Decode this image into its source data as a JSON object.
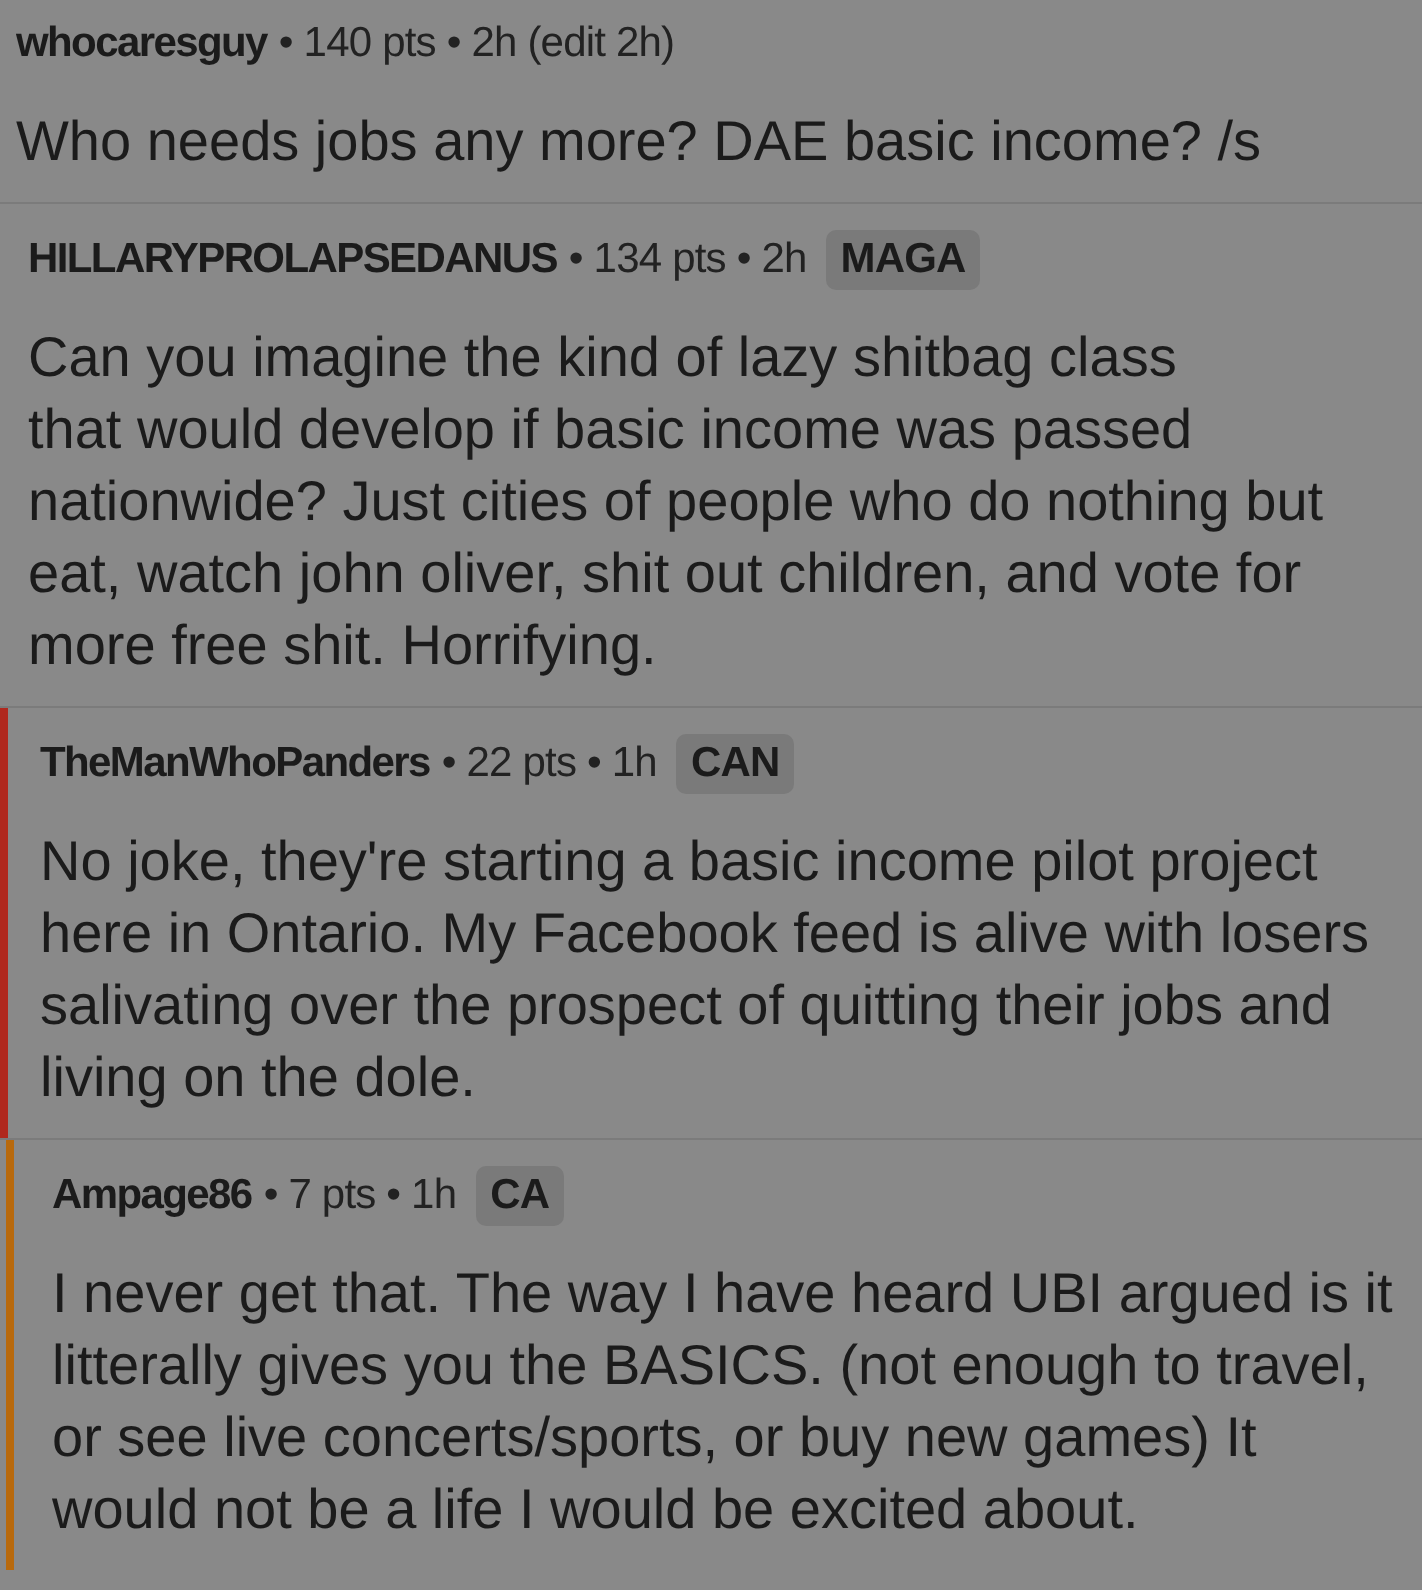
{
  "comments": [
    {
      "author": "whocaresguy",
      "meta": "• 140 pts • 2h (edit 2h)",
      "body": "Who needs jobs any more? DAE basic income? /s",
      "children": [
        {
          "author": "HILLARYPROLAPSEDANUS",
          "meta": "• 134 pts • 2h",
          "flair": "MAGA",
          "body": "Can you imagine the kind of lazy shitbag class\nthat would develop if basic income was passed nationwide? Just cities of people who do nothing but eat, watch john oliver, shit out children, and vote for more free shit. Horrifying.",
          "children": [
            {
              "author": "TheManWhoPanders",
              "meta": "• 22 pts • 1h",
              "flair": "CAN",
              "color": "#b0281e",
              "body": "No joke, they're starting a basic income pilot project here in Ontario. My Facebook feed is alive with losers salivating over the prospect of quitting their jobs and living on the dole.",
              "children": [
                {
                  "author": "Ampage86",
                  "meta": "• 7 pts • 1h",
                  "flair": "CA",
                  "color": "#b8690c",
                  "body": "I never get that. The way I have heard UBI argued is it litterally gives you the BASICS. (not enough to travel, or see live concerts/sports, or buy new games) It would not be a life I would be excited about."
                }
              ]
            }
          ]
        }
      ]
    }
  ]
}
